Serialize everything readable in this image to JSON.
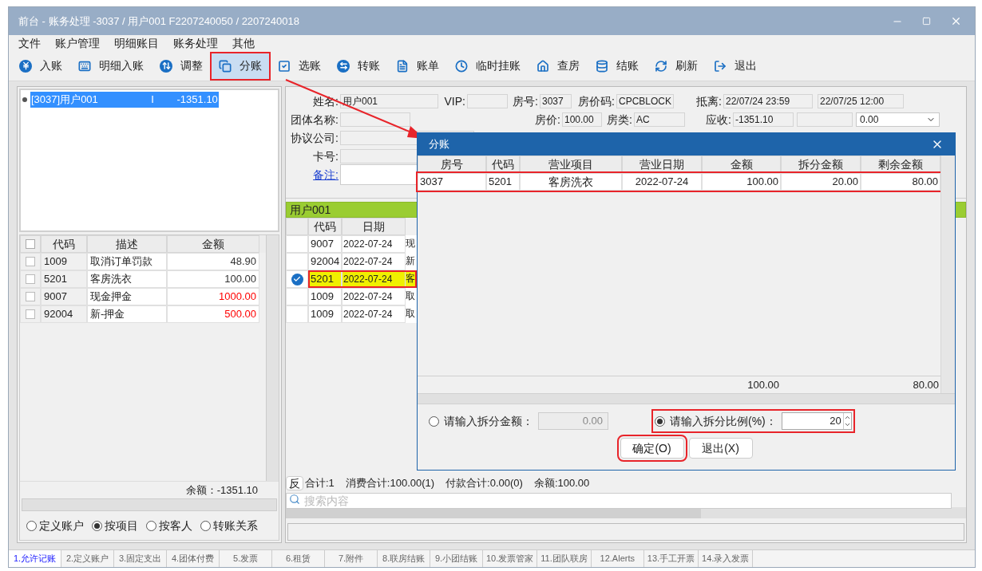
{
  "window": {
    "title": "前台 - 账务处理 -3037 / 用户001  F2207240050 / 2207240018"
  },
  "menu": [
    "文件",
    "账户管理",
    "明细账目",
    "账务处理",
    "其他"
  ],
  "toolbar": [
    {
      "label": "入账",
      "kind": "yen",
      "selected": false,
      "annotated": false
    },
    {
      "label": "明细入账",
      "kind": "keyboard",
      "selected": false,
      "annotated": false
    },
    {
      "label": "调整",
      "kind": "adjust",
      "selected": false,
      "annotated": false
    },
    {
      "label": "分账",
      "kind": "split",
      "selected": true,
      "annotated": true
    },
    {
      "label": "选账",
      "kind": "select",
      "selected": false,
      "annotated": false
    },
    {
      "label": "转账",
      "kind": "transfer",
      "selected": false,
      "annotated": false
    },
    {
      "label": "账单",
      "kind": "bill",
      "selected": false,
      "annotated": false
    },
    {
      "label": "临时挂账",
      "kind": "clock",
      "selected": false,
      "annotated": false
    },
    {
      "label": "查房",
      "kind": "house",
      "selected": false,
      "annotated": false
    },
    {
      "label": "结账",
      "kind": "coins",
      "selected": false,
      "annotated": false
    },
    {
      "label": "刷新",
      "kind": "refresh",
      "selected": false,
      "annotated": false
    },
    {
      "label": "退出",
      "kind": "exit",
      "selected": false,
      "annotated": false
    }
  ],
  "account_tree": [
    {
      "name": "[3037]用户001",
      "flag": "I",
      "amount": "-1351.10",
      "selected": true
    }
  ],
  "items_table": {
    "all_checked": false,
    "columns": [
      "代码",
      "描述",
      "金额"
    ],
    "rows": [
      {
        "code": "1009",
        "description": "取消订单罚款",
        "amount": "48.90",
        "checked": false,
        "color": "#333333"
      },
      {
        "code": "5201",
        "description": "客房洗衣",
        "amount": "100.00",
        "checked": false,
        "color": "#333333"
      },
      {
        "code": "9007",
        "description": "现金押金",
        "amount": "1000.00",
        "checked": false,
        "color": "#ff0000"
      },
      {
        "code": "92004",
        "description": "新-押金",
        "amount": "500.00",
        "checked": false,
        "color": "#ff0000"
      }
    ]
  },
  "balance": "余额：-1351.10",
  "group_by": [
    {
      "label": "定义账户",
      "selected": false
    },
    {
      "label": "按项目",
      "selected": true
    },
    {
      "label": "按客人",
      "selected": false
    },
    {
      "label": "转账关系",
      "selected": false
    }
  ],
  "guest_info": [
    [
      {
        "label": "姓名:",
        "value": "用户001"
      },
      {
        "label": "VIP:"
      },
      {
        "label": "房号:",
        "value": "3037"
      },
      {
        "label": "房价码:",
        "value": "CPCBLOCK"
      },
      {
        "label": "抵离:",
        "value": "22/07/24 23:59"
      },
      {
        "value": "22/07/25 12:00"
      }
    ],
    [
      {
        "label": "团体名称:"
      },
      {
        "label": "房价:",
        "value": "100.00"
      },
      {
        "label": "房类:",
        "value": "AC"
      },
      {
        "label": "应收:",
        "value": "-1351.10"
      },
      {
        "kind": "field"
      },
      {
        "value": "0.00",
        "kind": "dropdown"
      }
    ],
    [
      {
        "label": "协议公司:"
      }
    ],
    [
      {
        "label": "卡号:"
      }
    ],
    [
      {
        "label": "备注:",
        "kind": "link"
      }
    ]
  ],
  "folio": {
    "title": "用户001",
    "columns": [
      "代码",
      "日期"
    ],
    "rows": [
      {
        "code": "9007",
        "date": "2022-07-24",
        "item": "现",
        "selected": false,
        "annotated": false
      },
      {
        "code": "92004",
        "date": "2022-07-24",
        "item": "新",
        "selected": false,
        "annotated": false
      },
      {
        "code": "5201",
        "date": "2022-07-24",
        "item": "客",
        "selected": true,
        "annotated": true
      },
      {
        "code": "1009",
        "date": "2022-07-24",
        "item": "取",
        "selected": false,
        "annotated": false
      },
      {
        "code": "1009",
        "date": "2022-07-24",
        "item": "取",
        "selected": false,
        "annotated": false
      }
    ],
    "reverse": "反",
    "summary": [
      "合计:1",
      "消费合计:100.00(1)",
      "付款合计:0.00(0)",
      "余额:100.00"
    ],
    "search": {
      "placeholder": "搜索内容"
    }
  },
  "bottom_tabs": [
    {
      "label": "1.允许记账",
      "selected": true
    },
    {
      "label": "2.定义账户",
      "selected": false
    },
    {
      "label": "3.固定支出",
      "selected": false
    },
    {
      "label": "4.团体付费",
      "selected": false
    },
    {
      "label": "5.发票",
      "selected": false
    },
    {
      "label": "6.租赁",
      "selected": false
    },
    {
      "label": "7.附件",
      "selected": false
    },
    {
      "label": "8.联房结账",
      "selected": false
    },
    {
      "label": "9.小团结账",
      "selected": false
    },
    {
      "label": "10.发票管家",
      "selected": false
    },
    {
      "label": "11.团队联房",
      "selected": false
    },
    {
      "label": "12.Alerts",
      "selected": false
    },
    {
      "label": "13.手工开票",
      "selected": false
    },
    {
      "label": "14.录入发票",
      "selected": false
    }
  ],
  "split_dialog": {
    "title": "分账",
    "columns": [
      "房号",
      "代码",
      "营业项目",
      "营业日期",
      "金额",
      "拆分金额",
      "剩余金额"
    ],
    "rows": [
      {
        "cells": [
          "3037",
          "5201",
          "客房洗衣",
          "2022-07-24",
          "100.00",
          "20.00",
          "80.00"
        ],
        "annotated": true
      }
    ],
    "totals": {
      "amount": "100.00",
      "remaining": "80.00"
    },
    "options": [
      {
        "label": "请输入拆分金额：",
        "value": "0.00",
        "selected": false,
        "disabled": true,
        "annotated": false
      },
      {
        "label": "请输入拆分比例(%)：",
        "value": "20",
        "selected": true,
        "disabled": false,
        "annotated": true
      }
    ],
    "buttons": [
      {
        "label": "确定(O)",
        "annotated": true
      },
      {
        "label": "退出(X)",
        "annotated": false
      }
    ]
  }
}
